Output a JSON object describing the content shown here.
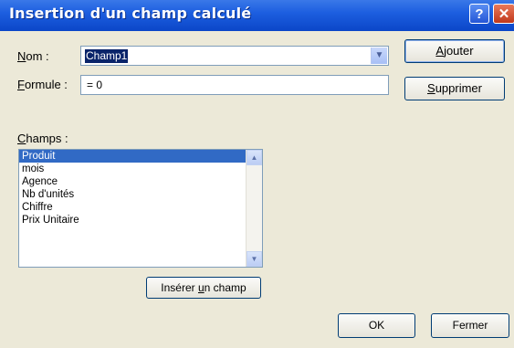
{
  "window": {
    "title": "Insertion d'un champ calculé",
    "help_glyph": "?",
    "close_glyph": "✕"
  },
  "form": {
    "nom_label_accel": "N",
    "nom_label_rest": "om :",
    "nom_value": "Champ1",
    "formule_label_accel": "F",
    "formule_label_rest": "ormule :",
    "formule_value": "= 0",
    "champs_label_accel": "C",
    "champs_label_rest": "hamps :"
  },
  "buttons": {
    "ajouter_accel": "A",
    "ajouter_rest": "jouter",
    "supprimer_accel": "S",
    "supprimer_rest": "upprimer",
    "inserer_pre": "Insérer ",
    "inserer_accel": "u",
    "inserer_post": "n champ",
    "ok": "OK",
    "fermer": "Fermer"
  },
  "champs": {
    "items": [
      "Produit",
      "mois",
      "Agence",
      "Nb d'unités",
      "Chiffre",
      "Prix Unitaire"
    ],
    "selected_index": 0
  },
  "icons": {
    "dropdown": "chevron-down-icon",
    "scroll_up": "scroll-up-arrow-icon",
    "scroll_down": "scroll-down-arrow-icon"
  }
}
